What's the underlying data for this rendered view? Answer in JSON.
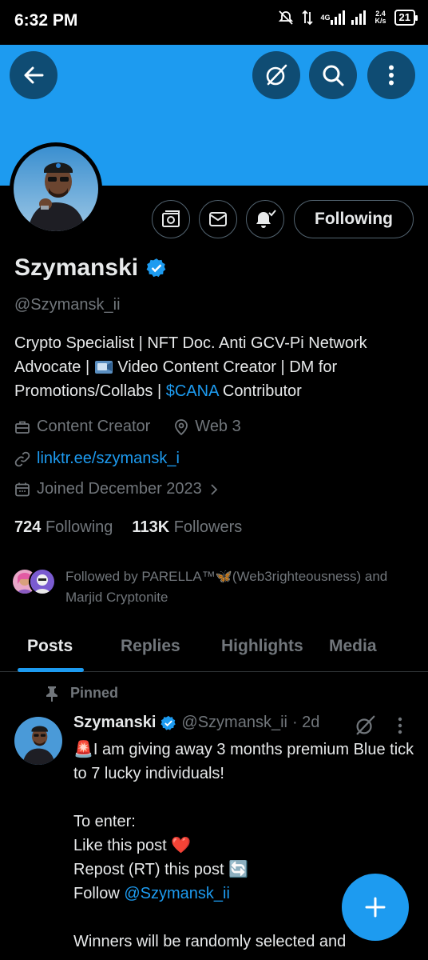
{
  "status_bar": {
    "time": "6:32 PM",
    "network_type": "4G",
    "net_speed": "2.4",
    "net_speed_unit": "K/s",
    "battery": "21"
  },
  "colors": {
    "banner": "#1d9bf0",
    "accent": "#1d9bf0",
    "background": "#000000",
    "verified": "#1d9bf0"
  },
  "header": {
    "back_icon": "arrow-left-icon",
    "grok_icon": "grok-icon",
    "search_icon": "search-icon",
    "more_icon": "more-vertical-icon"
  },
  "profile": {
    "name": "Szymanski",
    "handle": "@Szymansk_ii",
    "bio_part1": "Crypto Specialist | NFT Doc. Anti GCV-Pi Network Advocate | ",
    "bio_part2": " Video Content Creator | DM for Promotions/Collabs | ",
    "bio_cashtag": "$CANA",
    "bio_part3": " Contributor",
    "category": "Content Creator",
    "location": "Web 3",
    "website": "linktr.ee/szymansk_i",
    "joined": "Joined December 2023",
    "following_count": "724",
    "following_label": "Following",
    "followers_count": "113K",
    "followers_label": "Followers",
    "followed_by": "Followed by PARELLA™🦋(Web3righteousness) and Marjid Cryptonite",
    "following_button": "Following"
  },
  "tabs": [
    "Posts",
    "Replies",
    "Highlights",
    "Media"
  ],
  "active_tab": "Posts",
  "pinned_post": {
    "pinned_label": "Pinned",
    "author": "Szymanski",
    "handle": "@Szymansk_ii",
    "time": "· 2d",
    "line1": "🚨I am giving away 3 months premium Blue tick to 7 lucky individuals!",
    "line2": "To enter:",
    "line3": "Like this post ❤️",
    "line4": "Repost (RT) this post 🔄",
    "line5_prefix": "Follow ",
    "line5_mention": "@Szymansk_ii",
    "line6": "Winners will be randomly selected and"
  },
  "fab_icon": "plus-icon"
}
